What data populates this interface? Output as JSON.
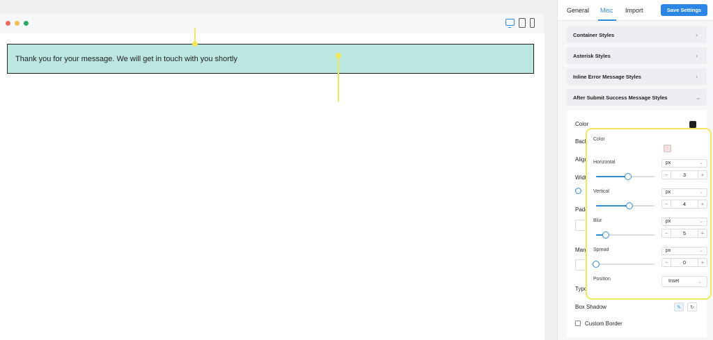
{
  "preview": {
    "success_message": "Thank you for your message. We will get in touch with you shortly"
  },
  "tabs": [
    {
      "label": "General"
    },
    {
      "label": "Misc",
      "active": true
    },
    {
      "label": "Import"
    }
  ],
  "save_button": "Save Settings",
  "sections": [
    {
      "label": "Container Styles"
    },
    {
      "label": "Asterisk Styles"
    },
    {
      "label": "Inline Error Message Styles"
    },
    {
      "label": "After Submit Success Message Styles"
    }
  ],
  "submit_panel": {
    "color_label": "Color",
    "background_label": "Back",
    "alignment_label": "Align",
    "width_label": "Widt",
    "padding_label": "Padd",
    "margin_label": "Marg",
    "typography_label": "Typo",
    "box_shadow_label": "Box Shadow",
    "custom_border_label": "Custom Border",
    "color_swatch": "#1e1e1e"
  },
  "box_shadow_popup": {
    "color_label": "Color",
    "color_value": "#f4dede",
    "horizontal": {
      "label": "Horizontal",
      "unit": "px",
      "value": "3",
      "slider_fraction": 0.55
    },
    "vertical": {
      "label": "Vertical",
      "unit": "px",
      "value": "4",
      "slider_fraction": 0.57
    },
    "blur": {
      "label": "Blur",
      "unit": "px",
      "value": "5",
      "slider_fraction": 0.17
    },
    "spread": {
      "label": "Spread",
      "unit": "px",
      "value": "0",
      "slider_fraction": 0.0
    },
    "position_label": "Position",
    "position_value": "Inset"
  },
  "icons": {
    "chevron": "chevron-right-icon",
    "stepper_minus": "−",
    "stepper_plus": "+",
    "caret": "⌄",
    "reset": "↻",
    "edit": "✎"
  },
  "colors": {
    "accent": "#2f8ad8",
    "success_bg": "#bce6e0",
    "annotation": "#f2e65a"
  }
}
